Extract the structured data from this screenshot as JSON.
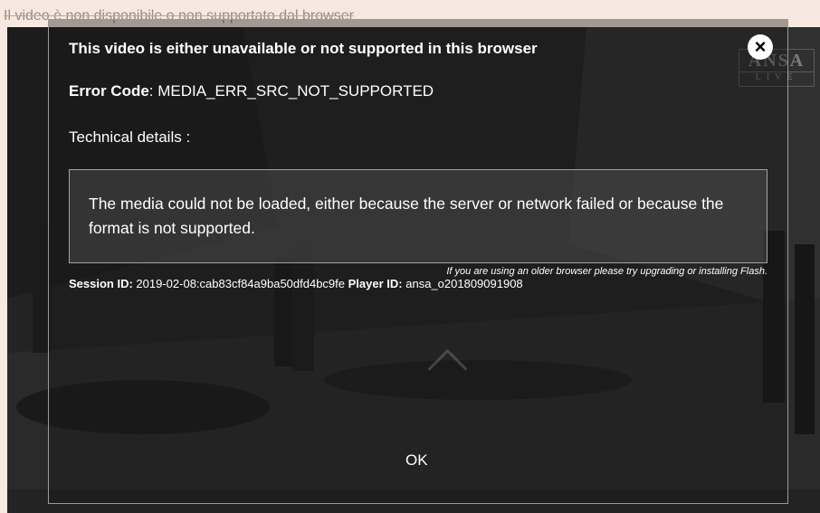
{
  "page": {
    "background_notice": "Il video è non disponibile o non supportato dal browser"
  },
  "player": {
    "logo_top": "ANSA",
    "logo_bottom": "LIVE"
  },
  "dialog": {
    "title": "This video is either unavailable or not supported in this browser",
    "close_icon": "close-circle-icon",
    "error_code_label": "Error Code",
    "error_code_value": "MEDIA_ERR_SRC_NOT_SUPPORTED",
    "technical_label": "Technical details :",
    "technical_message": "The media could not be loaded, either because the server or network failed or because the format is not supported.",
    "older_browser_hint": "If you are using an older browser please try upgrading or installing Flash.",
    "session_label": "Session ID:",
    "session_value": "2019-02-08:cab83cf84a9ba50dfd4bc9fe",
    "player_label": "Player ID:",
    "player_value": "ansa_o201809091908",
    "ok_label": "OK"
  },
  "colors": {
    "page_bg": "#f7e9df",
    "player_bg": "#262626",
    "dialog_text": "#ffffff",
    "border": "#9a9a9a"
  }
}
